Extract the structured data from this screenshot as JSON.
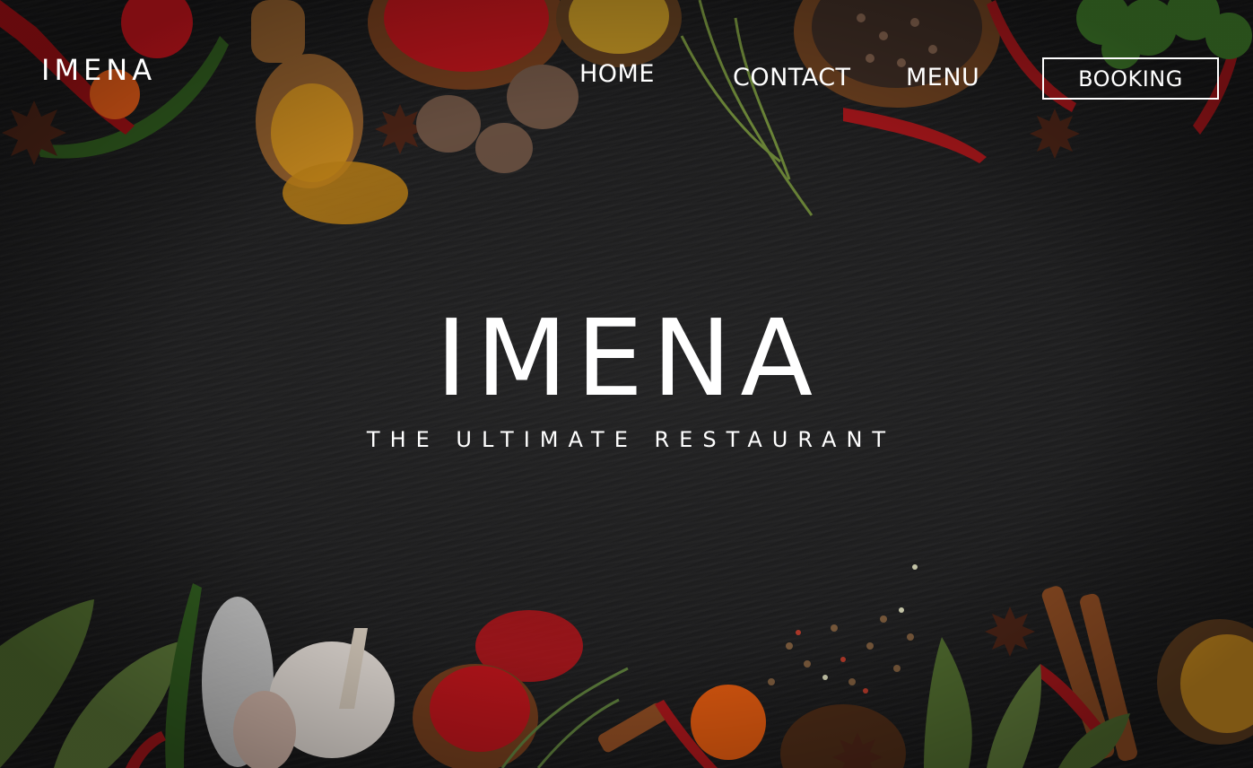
{
  "brand": {
    "logo": "IMENA"
  },
  "nav": {
    "home": "HOME",
    "contact": "CONTACT",
    "menu": "MENU",
    "booking": "BOOKING"
  },
  "hero": {
    "title": "IMENA",
    "subtitle": "THE ULTIMATE RESTAURANT"
  },
  "colors": {
    "background": "#1b1b1c",
    "text": "#ffffff",
    "accent_red": "#b3141a",
    "accent_turmeric": "#c98a1a",
    "accent_green": "#3f6b2a"
  }
}
